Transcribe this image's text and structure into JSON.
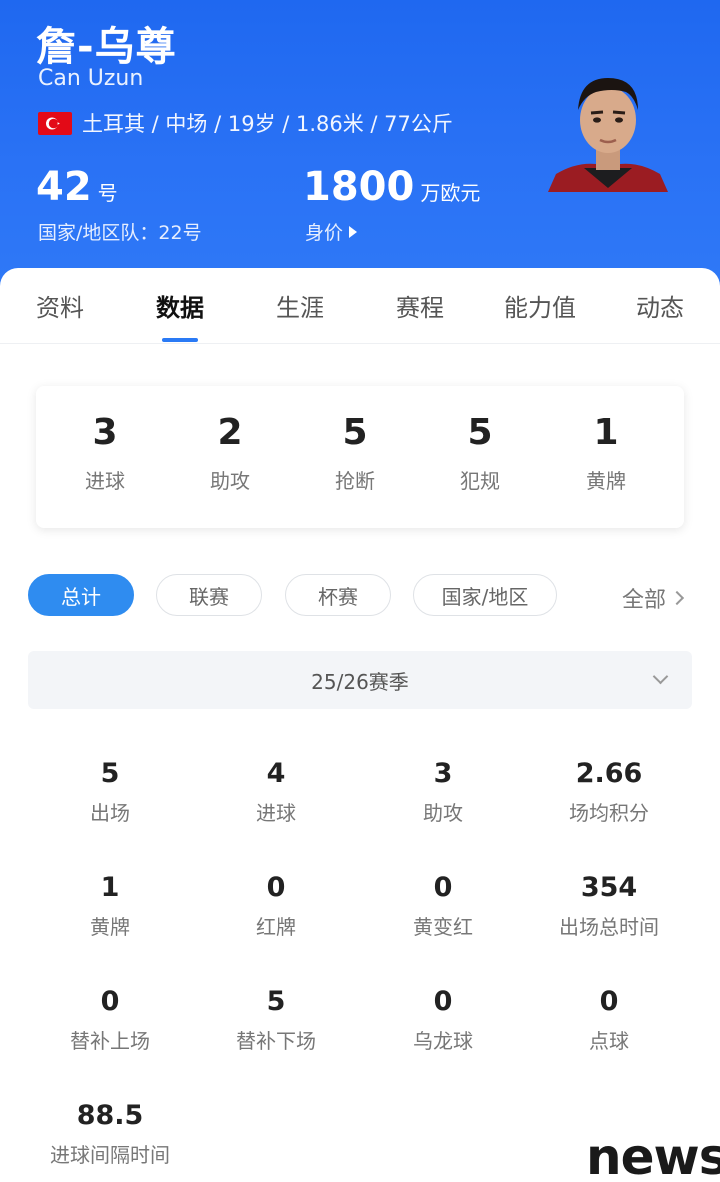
{
  "header": {
    "name_cn": "詹-乌尊",
    "name_en": "Can Uzun",
    "info": "土耳其 / 中场 / 19岁 / 1.86米 / 77公斤",
    "shirt_number": "42",
    "shirt_unit": "号",
    "national_team": "国家/地区队：22号",
    "market_value": "1800",
    "market_unit": "万欧元",
    "market_label": "身价"
  },
  "tabs": [
    "资料",
    "数据",
    "生涯",
    "赛程",
    "能力值",
    "动态"
  ],
  "active_tab": "数据",
  "summary": [
    {
      "value": "3",
      "label": "进球"
    },
    {
      "value": "2",
      "label": "助攻"
    },
    {
      "value": "5",
      "label": "抢断"
    },
    {
      "value": "5",
      "label": "犯规"
    },
    {
      "value": "1",
      "label": "黄牌"
    }
  ],
  "filters": [
    "总计",
    "联赛",
    "杯赛",
    "国家/地区"
  ],
  "filter_all": "全部",
  "season": "25/26赛季",
  "stats": [
    {
      "value": "5",
      "label": "出场"
    },
    {
      "value": "4",
      "label": "进球"
    },
    {
      "value": "3",
      "label": "助攻"
    },
    {
      "value": "2.66",
      "label": "场均积分"
    },
    {
      "value": "1",
      "label": "黄牌"
    },
    {
      "value": "0",
      "label": "红牌"
    },
    {
      "value": "0",
      "label": "黄变红"
    },
    {
      "value": "354",
      "label": "出场总时间"
    },
    {
      "value": "0",
      "label": "替补上场"
    },
    {
      "value": "5",
      "label": "替补下场"
    },
    {
      "value": "0",
      "label": "乌龙球"
    },
    {
      "value": "0",
      "label": "点球"
    },
    {
      "value": "88.5",
      "label": "进球间隔时间"
    }
  ],
  "watermark": "news",
  "colors": {
    "header_blue": "#2a72f5",
    "accent": "#2f8cf0",
    "flag_red": "#e30a17"
  }
}
